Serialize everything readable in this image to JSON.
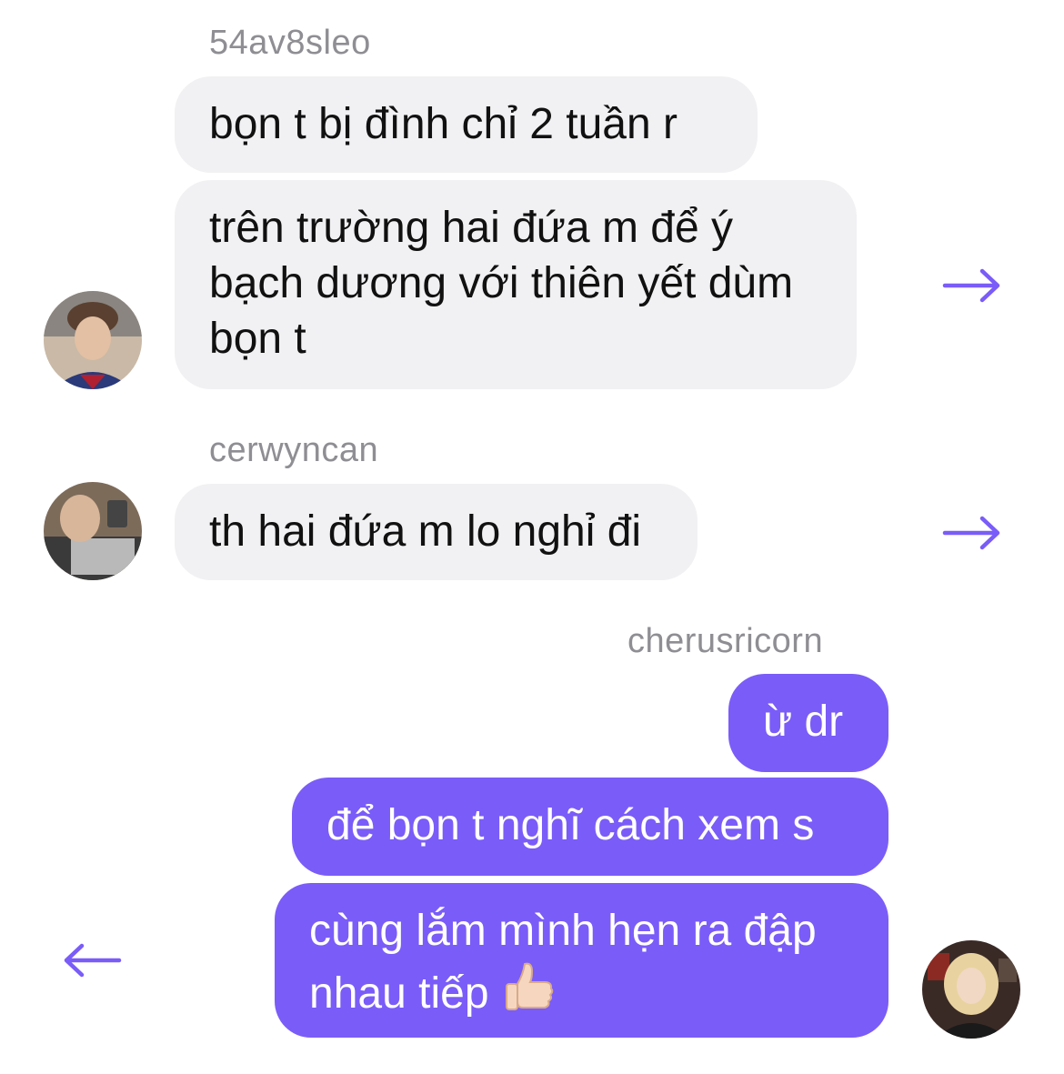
{
  "accent": "#7a5cf8",
  "messages": {
    "group1": {
      "sender": "54av8sleo",
      "bubble1": "bọn t bị đình chỉ 2 tuần r",
      "bubble2_line1": "trên trường hai đứa m để ý",
      "bubble2_line2": "bạch dương với thiên yết dùm",
      "bubble2_line3": "bọn t",
      "avatar": "avatar-54av8sleo",
      "action": "arrow-right-icon"
    },
    "group2": {
      "sender": "cerwyncan",
      "bubble1": "th hai đứa m lo nghỉ đi",
      "avatar": "avatar-cerwyncan",
      "action": "arrow-right-icon"
    },
    "group3": {
      "sender": "cherusricorn",
      "bubble1": "ừ dr",
      "bubble2": "để bọn t nghĩ cách xem s",
      "bubble3_line1": "cùng lắm mình hẹn ra đập",
      "bubble3_line2": "nhau tiếp",
      "bubble3_emoji": "thumbs-up-icon",
      "avatar": "avatar-cherusricorn",
      "action": "arrow-left-icon"
    }
  }
}
